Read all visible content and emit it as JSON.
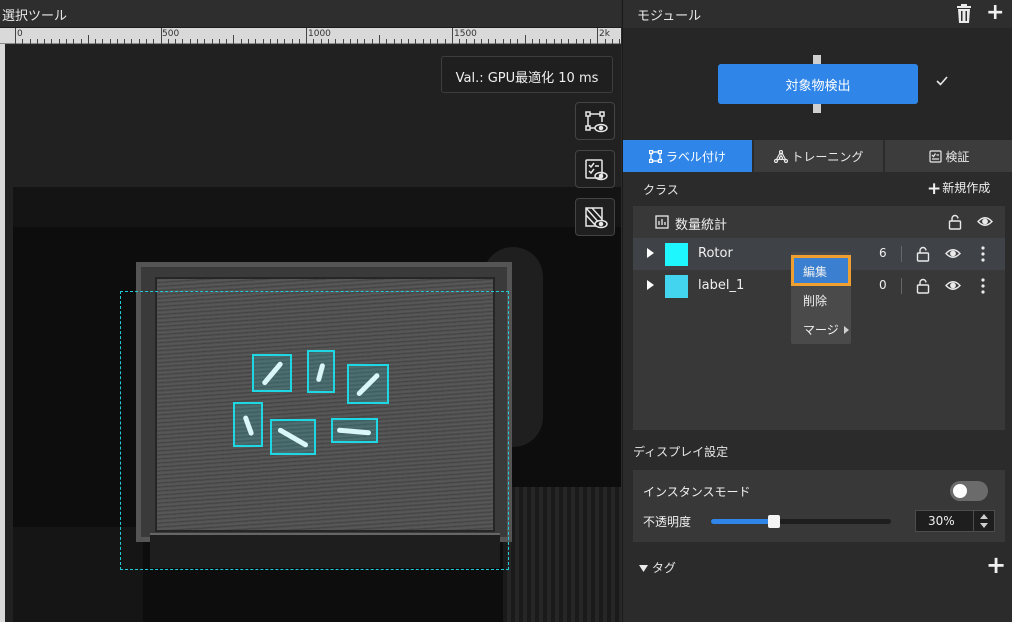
{
  "left_panel": {
    "title": "選択ツール",
    "ruler_labels": [
      "0",
      "500",
      "1000",
      "1500",
      "2k"
    ],
    "val_badge": "Val.: GPU最適化 10 ms",
    "tools": [
      "bounding-box-visibility-icon",
      "checklist-visibility-icon",
      "mask-visibility-icon"
    ]
  },
  "right_panel": {
    "title": "モジュール",
    "module": {
      "label": "対象物検出",
      "status_icon": "check-icon"
    },
    "tabs": [
      {
        "label": "ラベル付け",
        "icon": "label-tool-icon",
        "active": true
      },
      {
        "label": "トレーニング",
        "icon": "network-icon",
        "active": false
      },
      {
        "label": "検証",
        "icon": "validation-icon",
        "active": false
      }
    ],
    "classes": {
      "heading": "クラス",
      "new_label": "新規作成",
      "stats_label": "数量統計",
      "items": [
        {
          "name": "Rotor",
          "count": "6",
          "color": "#1ff7ff"
        },
        {
          "name": "label_1",
          "count": "0",
          "color": "#43d4f0"
        }
      ]
    },
    "context_menu": {
      "edit": "編集",
      "delete": "削除",
      "merge": "マージ"
    },
    "display": {
      "heading": "ディスプレイ設定",
      "instance_mode_label": "インスタンスモード",
      "instance_mode_on": false,
      "opacity_label": "不透明度",
      "opacity_value": "30%",
      "opacity_fraction": 0.35
    },
    "tags": {
      "heading": "タグ"
    }
  },
  "colors": {
    "accent": "#2f86e8",
    "detection": "#1fd6e3",
    "highlight": "#f0a030"
  }
}
